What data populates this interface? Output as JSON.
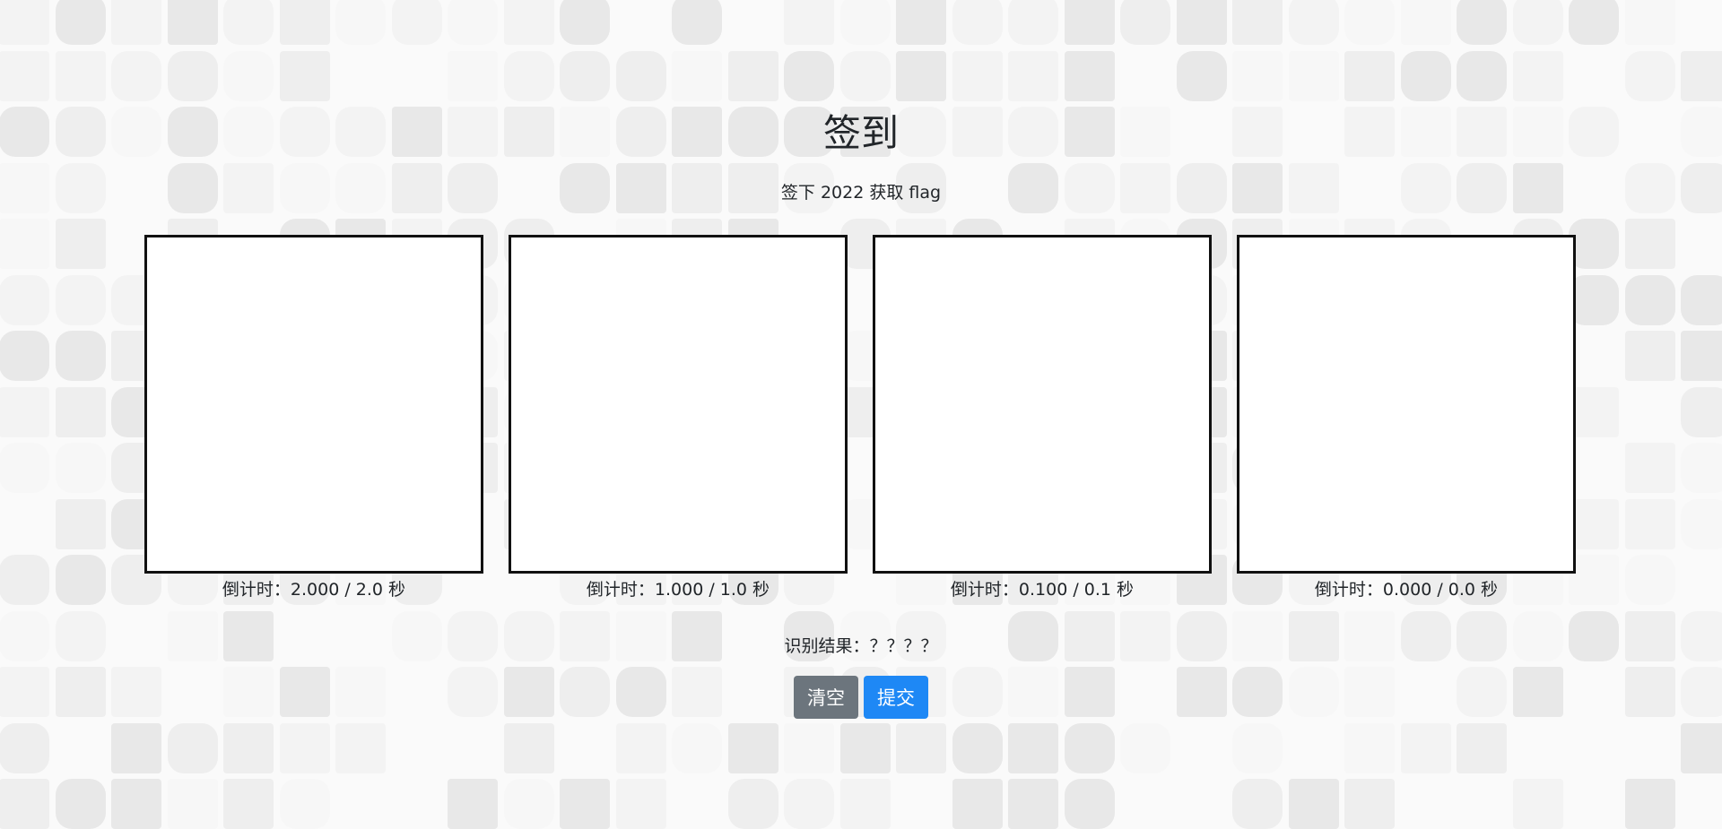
{
  "page": {
    "title": "签到",
    "subtitle": "签下 2022 获取 flag"
  },
  "pads": [
    {
      "countdown": "倒计时：2.000 / 2.0 秒"
    },
    {
      "countdown": "倒计时：1.000 / 1.0 秒"
    },
    {
      "countdown": "倒计时：0.100 / 0.1 秒"
    },
    {
      "countdown": "倒计时：0.000 / 0.0 秒"
    }
  ],
  "result": {
    "text": "识别结果：？？？？"
  },
  "buttons": {
    "clear_label": "清空",
    "submit_label": "提交"
  },
  "colors": {
    "clear_button": "#6c757d",
    "submit_button": "#1e88f5",
    "pad_border": "#111111",
    "background_tiles": [
      "#e8e8e8",
      "#eeeeee",
      "#f3f3f3",
      "#f7f7f7",
      "#fafafa"
    ]
  }
}
